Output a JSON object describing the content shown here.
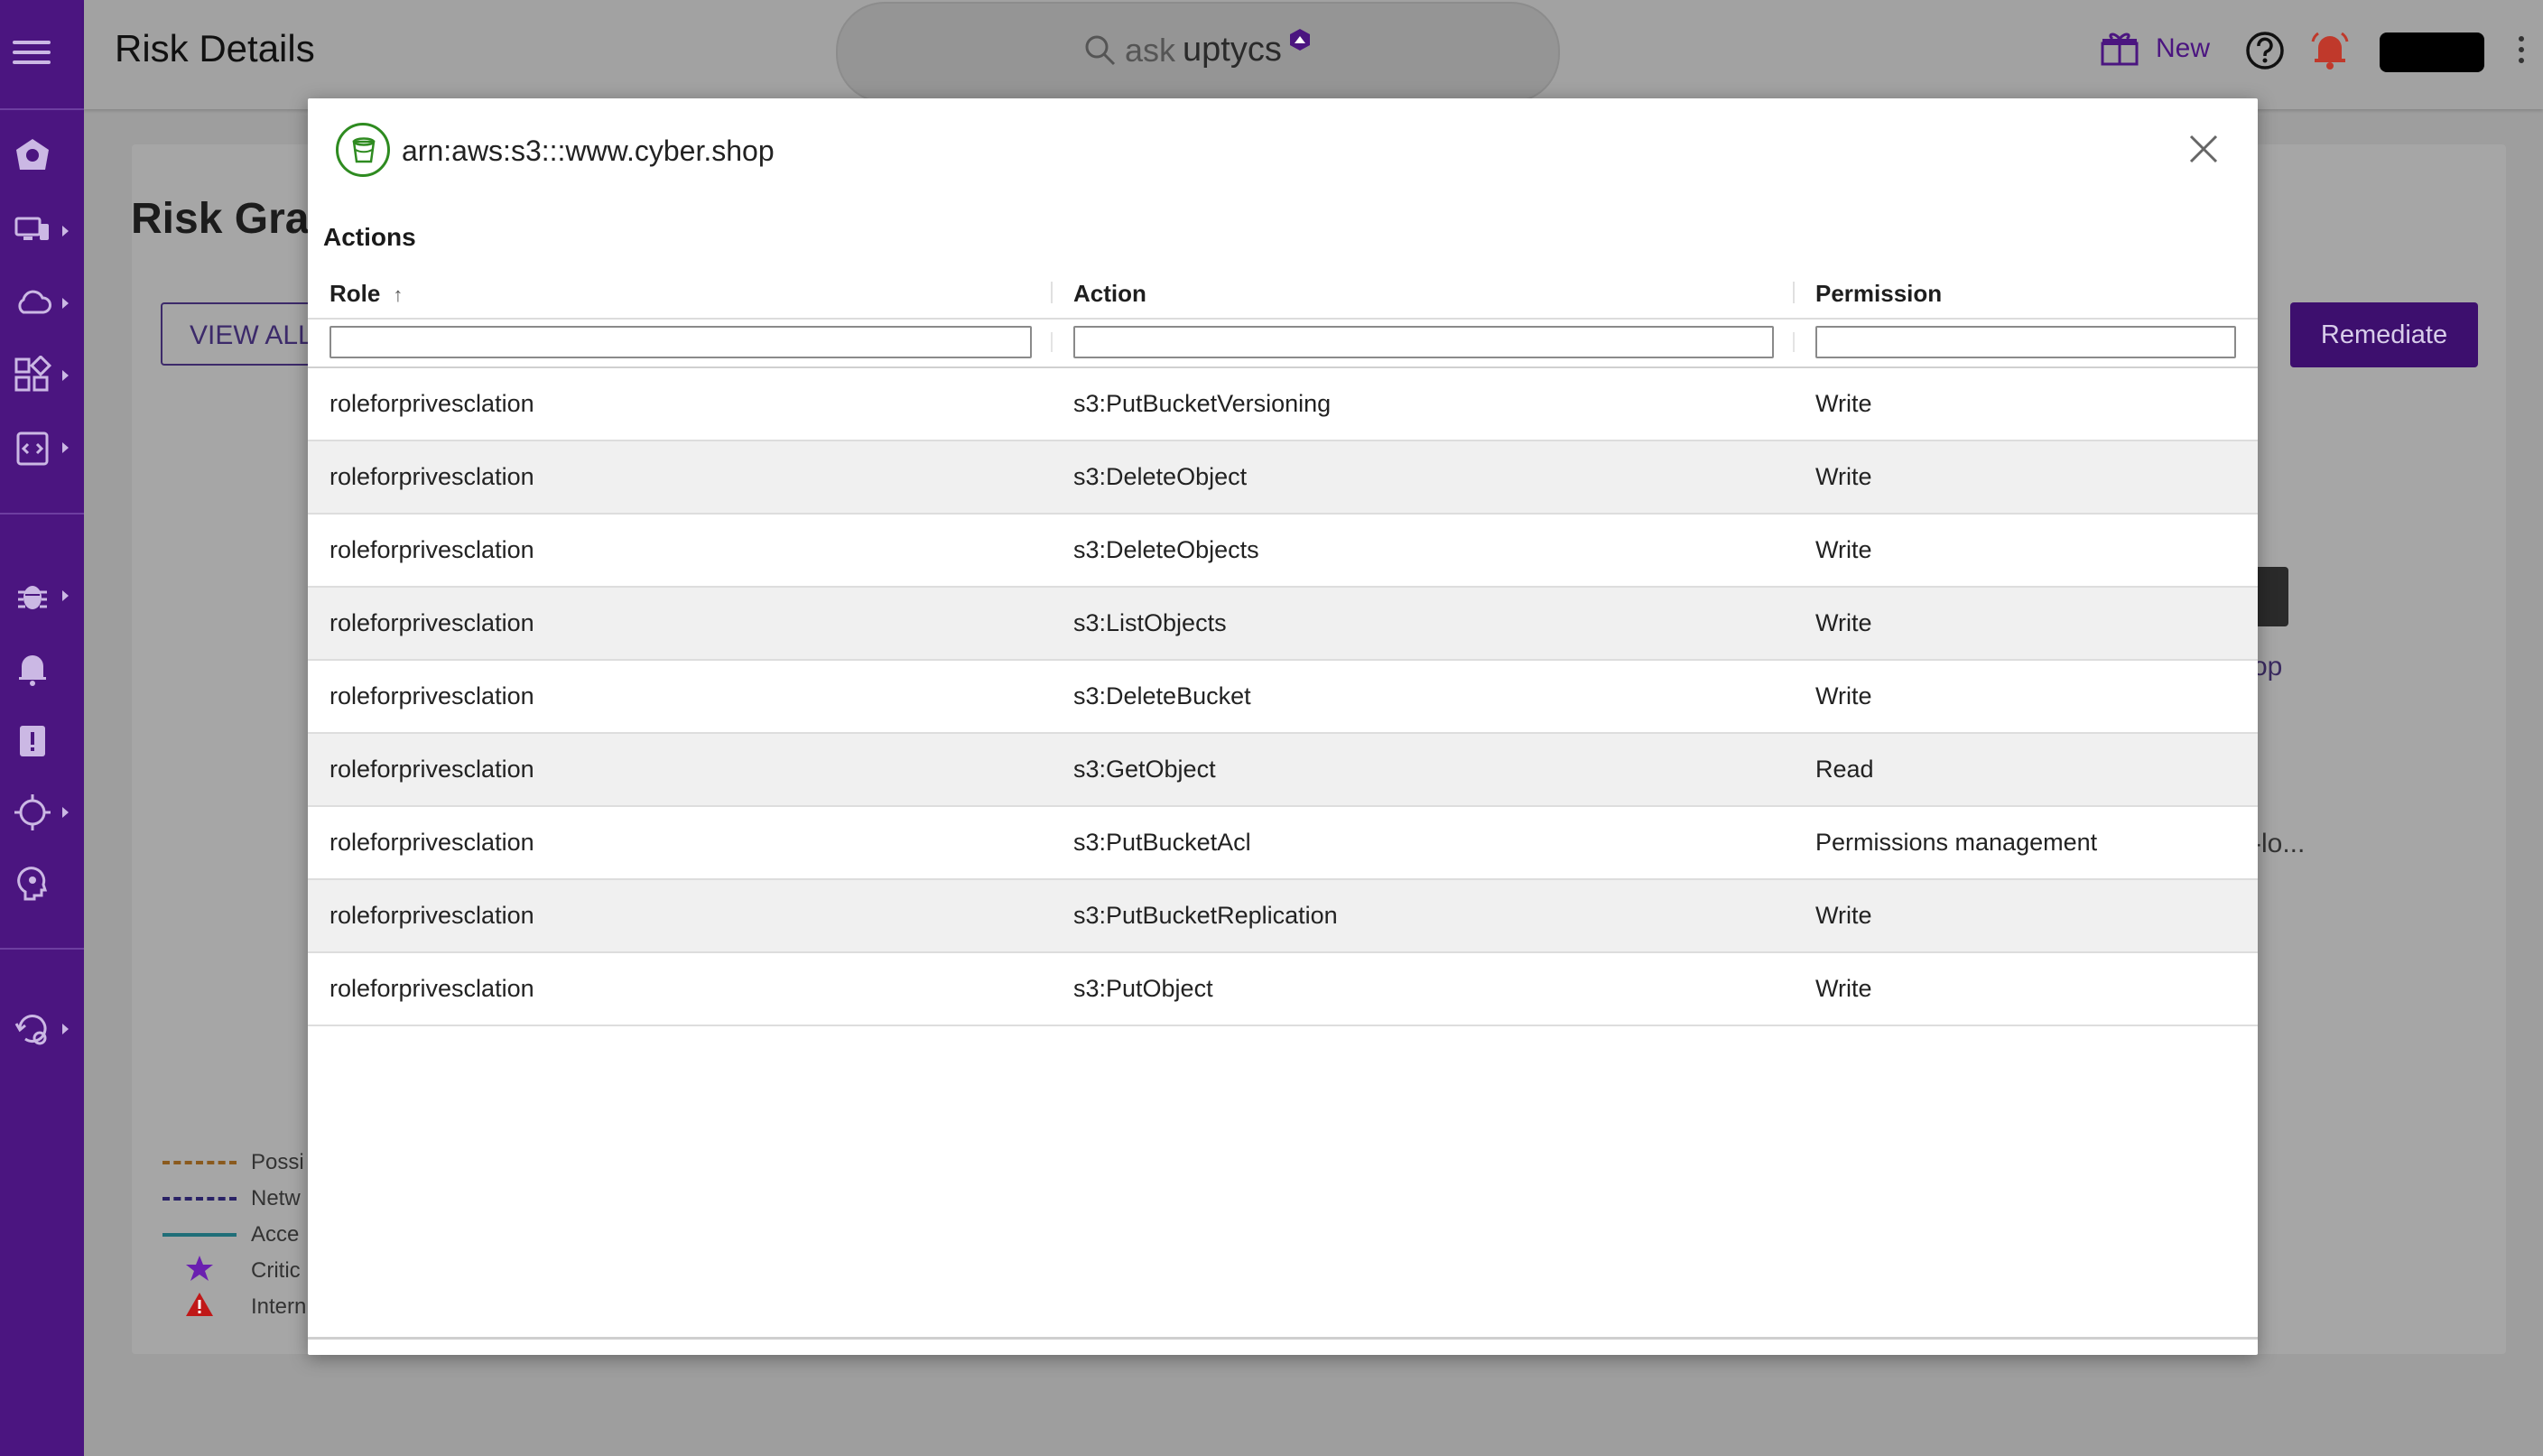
{
  "header": {
    "page_title": "Risk Details",
    "search": {
      "ask": "ask",
      "brand": "uptycs"
    },
    "new_label": "New"
  },
  "background": {
    "section_title": "Risk Gra",
    "view_all_label": "VIEW ALL",
    "remediate_label": "Remediate",
    "fragment_op": "op",
    "fragment_lo": "-lo...",
    "legend": [
      {
        "label": "Possi",
        "color": "#8a5a1e",
        "style": "dashed"
      },
      {
        "label": "Netw",
        "color": "#2a2266",
        "style": "dashed"
      },
      {
        "label": "Acce",
        "color": "#1f6e78",
        "style": "solid"
      },
      {
        "label": "Critic",
        "color": "#6a1fb0",
        "icon": "star-icon"
      },
      {
        "label": "Intern",
        "color": "#c01818",
        "icon": "warning-triangle-icon"
      }
    ]
  },
  "modal": {
    "title": "arn:aws:s3:::www.cyber.shop",
    "section_label": "Actions",
    "columns": {
      "role": "Role",
      "action": "Action",
      "permission": "Permission"
    },
    "sort": {
      "column": "Role",
      "direction": "ascending"
    },
    "rows": [
      {
        "role": "roleforprivesclation",
        "action": "s3:PutBucketVersioning",
        "permission": "Write"
      },
      {
        "role": "roleforprivesclation",
        "action": "s3:DeleteObject",
        "permission": "Write"
      },
      {
        "role": "roleforprivesclation",
        "action": "s3:DeleteObjects",
        "permission": "Write"
      },
      {
        "role": "roleforprivesclation",
        "action": "s3:ListObjects",
        "permission": "Write"
      },
      {
        "role": "roleforprivesclation",
        "action": "s3:DeleteBucket",
        "permission": "Write"
      },
      {
        "role": "roleforprivesclation",
        "action": "s3:GetObject",
        "permission": "Read"
      },
      {
        "role": "roleforprivesclation",
        "action": "s3:PutBucketAcl",
        "permission": "Permissions management"
      },
      {
        "role": "roleforprivesclation",
        "action": "s3:PutBucketReplication",
        "permission": "Write"
      },
      {
        "role": "roleforprivesclation",
        "action": "s3:PutObject",
        "permission": "Write"
      }
    ]
  },
  "colors": {
    "sidebar": "#4b1580",
    "accent": "#4b1580",
    "resource_icon": "#2e8b20",
    "alert": "#c0392b"
  }
}
